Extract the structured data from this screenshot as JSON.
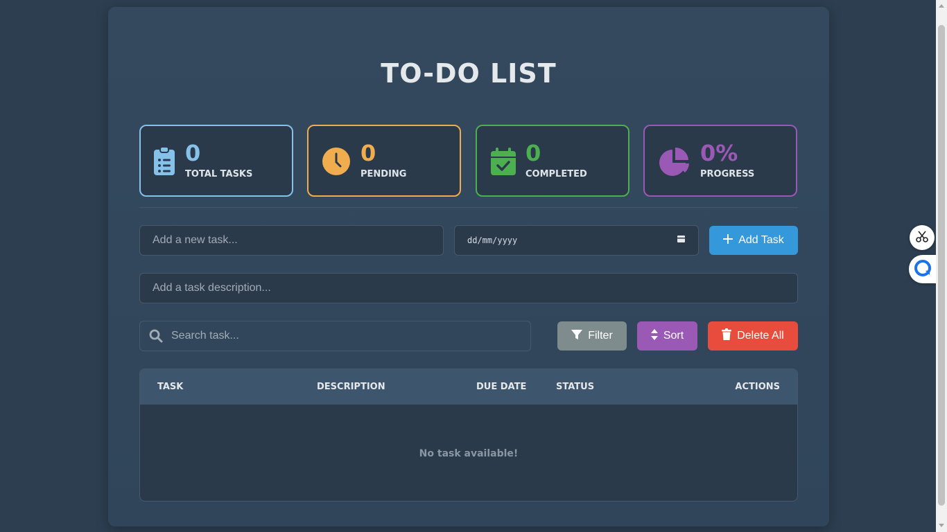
{
  "app": {
    "title": "TO-DO LIST"
  },
  "stats": [
    {
      "value": "0",
      "label": "TOTAL TASKS",
      "icon": "clipboard-list-icon",
      "color": "#85c1e9"
    },
    {
      "value": "0",
      "label": "PENDING",
      "icon": "clock-icon",
      "color": "#f0ad4e"
    },
    {
      "value": "0",
      "label": "COMPLETED",
      "icon": "calendar-check-icon",
      "color": "#4caf50"
    },
    {
      "value": "0%",
      "label": "PROGRESS",
      "icon": "chart-pie-icon",
      "color": "#9b59b6"
    }
  ],
  "form": {
    "task_placeholder": "Add a new task...",
    "date_placeholder": "dd/mm/yyyy",
    "add_button_label": "Add Task",
    "description_placeholder": "Add a task description..."
  },
  "toolbar": {
    "search_placeholder": "Search task...",
    "filter_label": "Filter",
    "sort_label": "Sort",
    "delete_all_label": "Delete All"
  },
  "table": {
    "headers": [
      "TASK",
      "DESCRIPTION",
      "DUE DATE",
      "STATUS",
      "ACTIONS"
    ],
    "empty_message": "No task available!"
  },
  "colors": {
    "background": "#2c3e50",
    "card": "#34495e",
    "add_button": "#3498db",
    "filter_button": "#7f8c8d",
    "sort_button": "#9b59b6",
    "delete_button": "#e74c3c"
  }
}
